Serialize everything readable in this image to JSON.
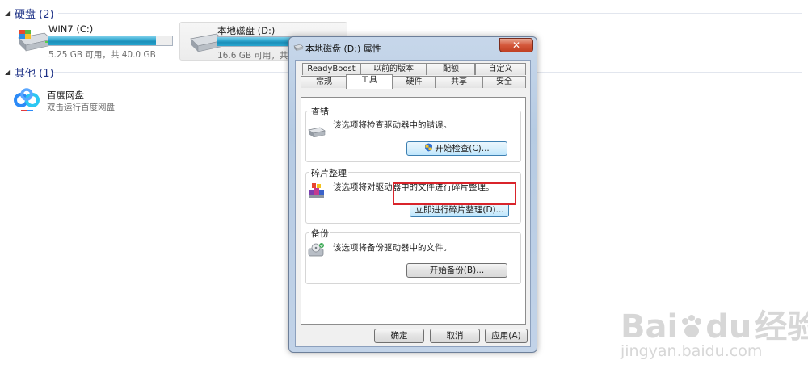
{
  "explorer": {
    "hard_disks_header": "硬盘 (2)",
    "drives": [
      {
        "name": "WIN7 (C:)",
        "info": "5.25 GB 可用，共 40.0 GB",
        "used_fraction": 0.87
      },
      {
        "name": "本地磁盘 (D:)",
        "info": "16.6 GB 可用，共 7",
        "used_fraction": 0.72
      }
    ],
    "other_header": "其他 (1)",
    "apps": [
      {
        "name": "百度网盘",
        "desc": "双击运行百度网盘"
      }
    ]
  },
  "dialog": {
    "title": "本地磁盘 (D:) 属性",
    "close_label": "✕",
    "tabs_row1": [
      "ReadyBoost",
      "以前的版本",
      "配额",
      "自定义"
    ],
    "tabs_row2": [
      "常规",
      "工具",
      "硬件",
      "共享",
      "安全"
    ],
    "active_tab": "工具",
    "sections": {
      "check": {
        "label": "查错",
        "text": "该选项将检查驱动器中的错误。",
        "button": "开始检查(C)..."
      },
      "defrag": {
        "label": "碎片整理",
        "text": "该选项将对驱动器中的文件进行碎片整理。",
        "button": "立即进行碎片整理(D)..."
      },
      "backup": {
        "label": "备份",
        "text": "该选项将备份驱动器中的文件。",
        "button": "开始备份(B)..."
      }
    },
    "footer": {
      "ok": "确定",
      "cancel": "取消",
      "apply": "应用(A)"
    }
  },
  "watermark": {
    "brand": "Bai",
    "brand2": "du",
    "brand_cn": "经验",
    "url": "jingyan.baidu.com"
  },
  "colors": {
    "highlight": "#d9242b",
    "bar_fill": "#1c8fba",
    "header_text": "#1e3287"
  }
}
